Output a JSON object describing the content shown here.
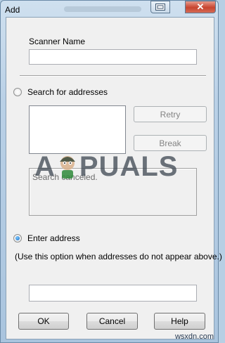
{
  "window": {
    "title": "Add",
    "close_glyph": "✕"
  },
  "form": {
    "scanner_name_label": "Scanner Name",
    "scanner_name_value": "",
    "search_radio_label": "Search for addresses",
    "search_selected": false,
    "retry_label": "Retry",
    "break_label": "Break",
    "status_text": "Search canceled.",
    "enter_radio_label": "Enter address",
    "enter_selected": true,
    "hint_text": "(Use this option when addresses do not appear above.)",
    "address_value": ""
  },
  "buttons": {
    "ok": "OK",
    "cancel": "Cancel",
    "help": "Help"
  },
  "overlay": {
    "watermark": "APPUALS",
    "watermark_left": "A",
    "watermark_right": "PUALS",
    "corner_mark": "wsxdn.com"
  },
  "icons": {
    "help_icon": "window-help-icon",
    "close_icon": "close-icon",
    "mascot": "mascot-logo"
  }
}
